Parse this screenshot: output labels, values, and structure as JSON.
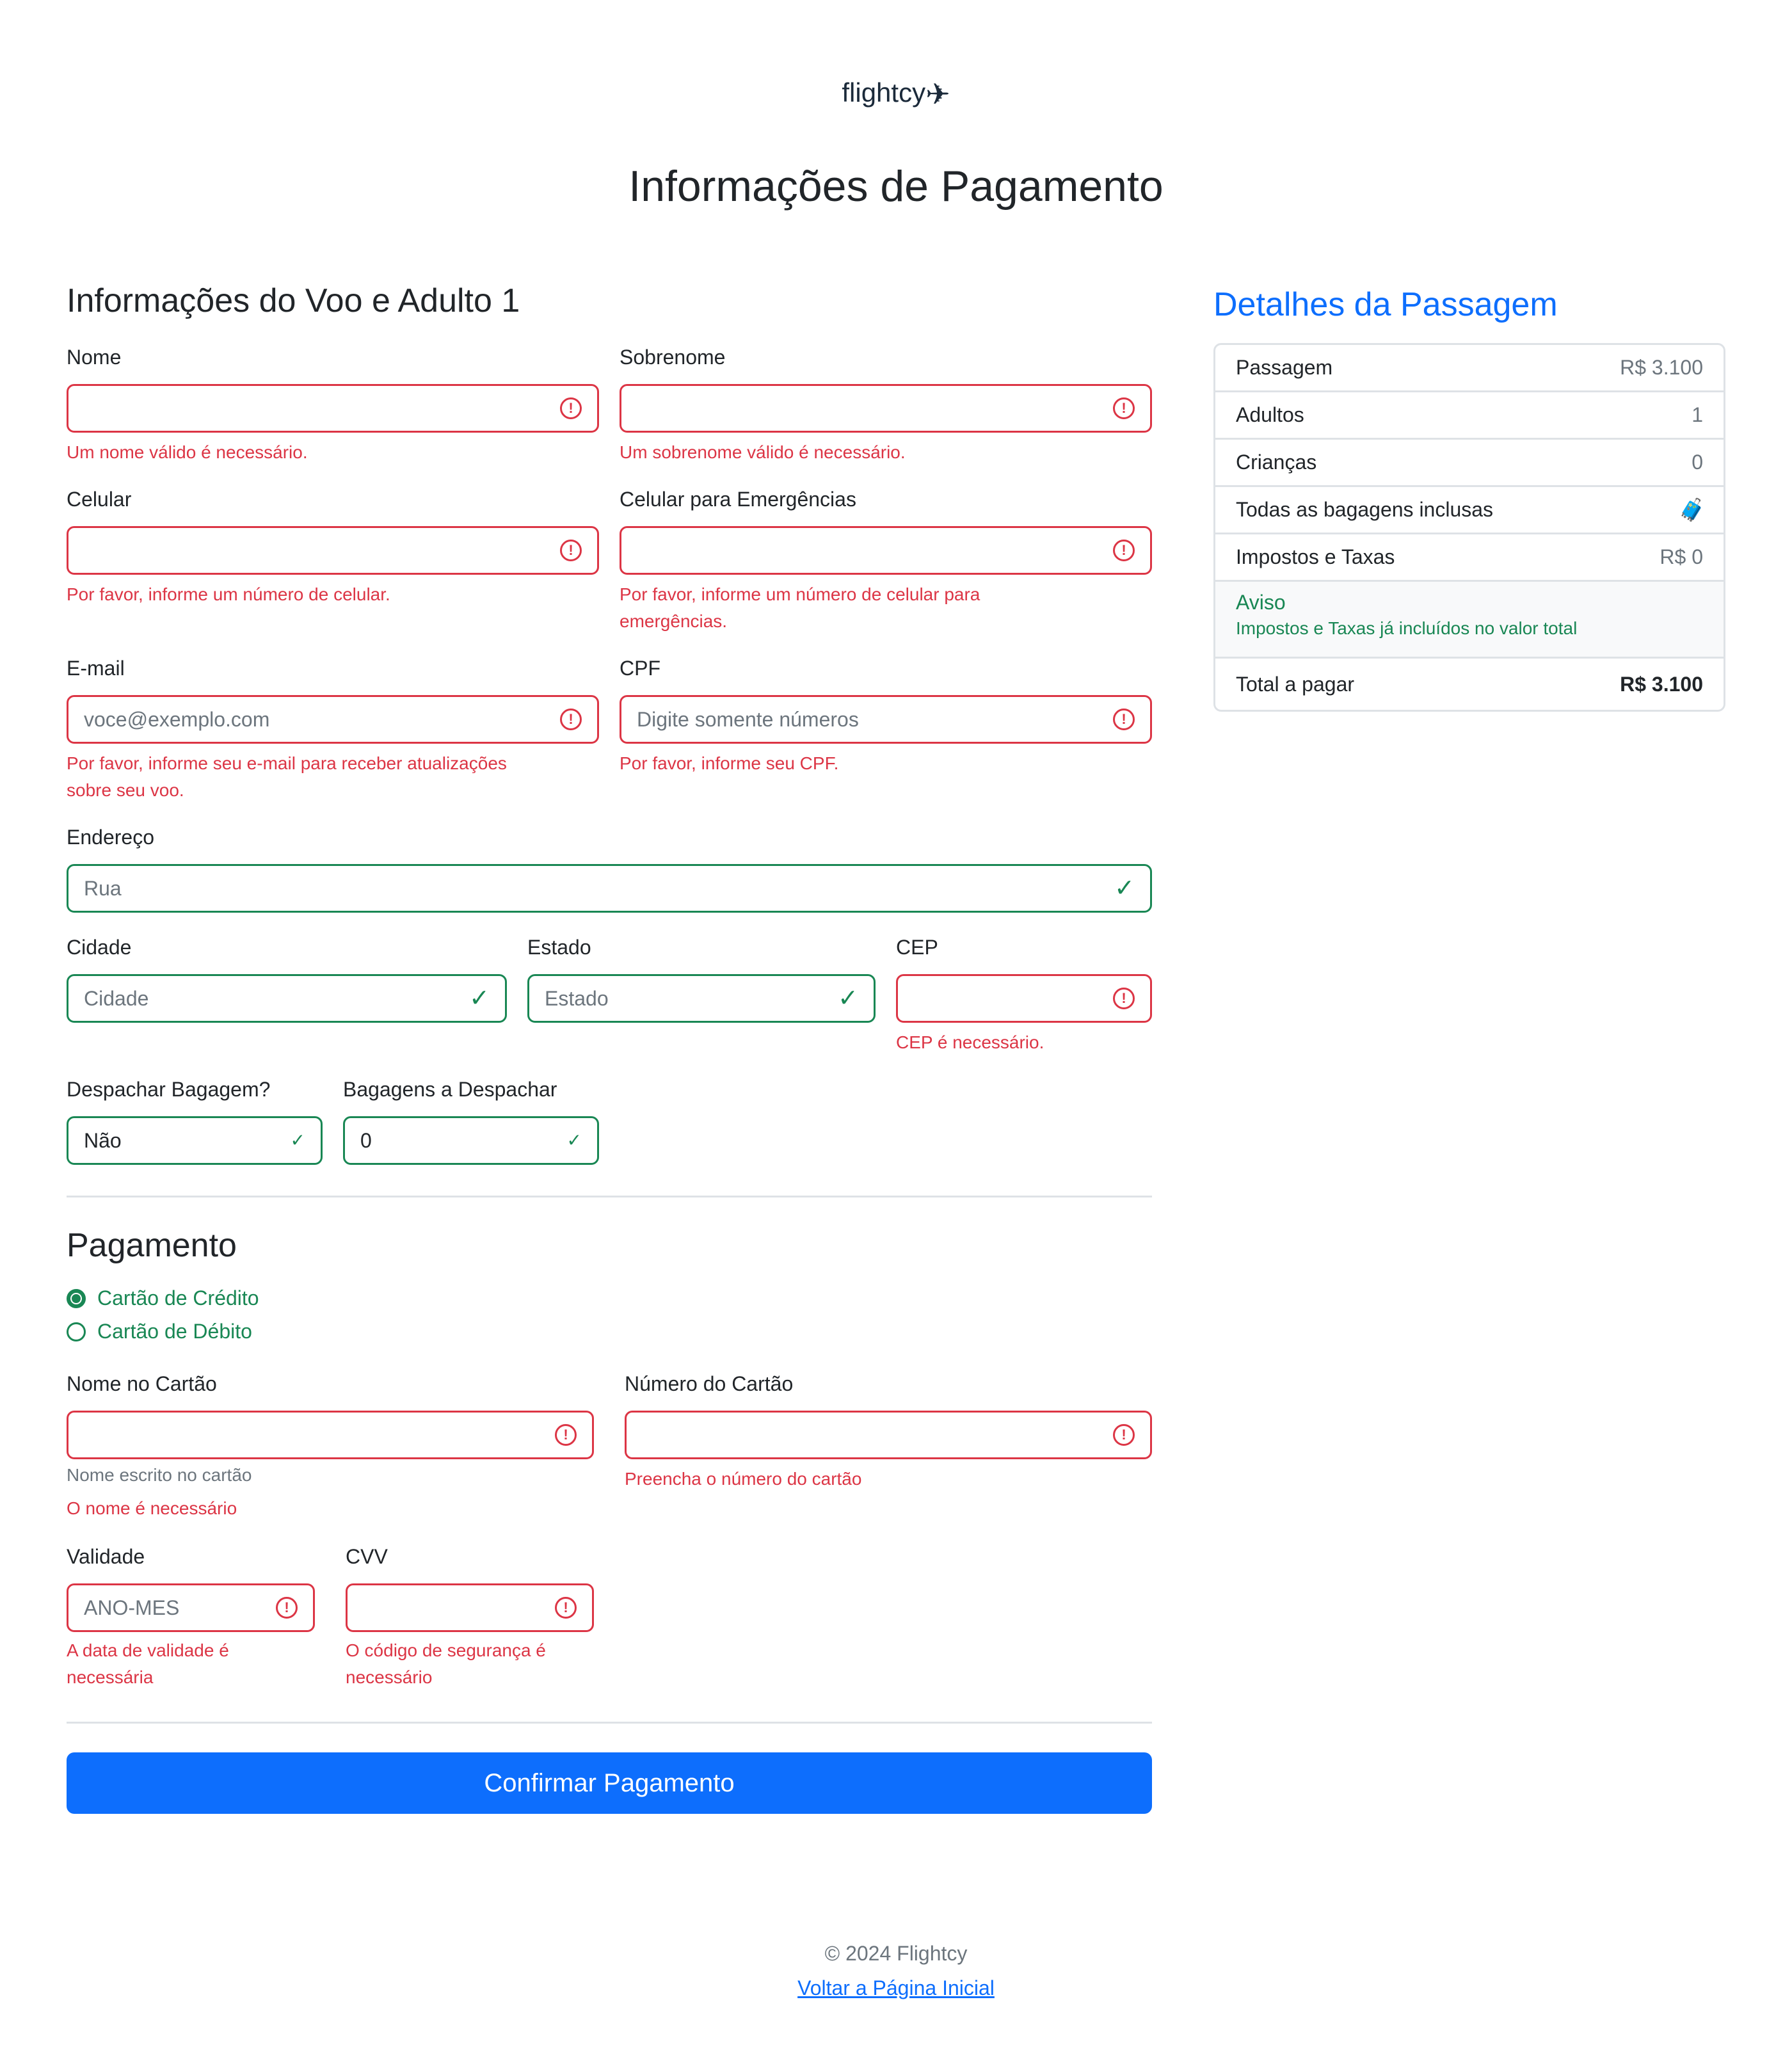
{
  "brand": {
    "logo_text": "flightcy",
    "logo_icon": "plane-icon"
  },
  "page_title": "Informações de Pagamento",
  "flight_section": {
    "title": "Informações do Voo e Adulto 1",
    "nome": {
      "label": "Nome",
      "value": "",
      "error": "Um nome válido é necessário."
    },
    "sobrenome": {
      "label": "Sobrenome",
      "value": "",
      "error": "Um sobrenome válido é necessário."
    },
    "celular": {
      "label": "Celular",
      "value": "",
      "error": "Por favor, informe um número de celular."
    },
    "celular_emergencia": {
      "label": "Celular para Emergências",
      "value": "",
      "error_line1": "Por favor, informe um número de celular para",
      "error_line2": "emergências."
    },
    "email": {
      "label": "E-mail",
      "placeholder": "voce@exemplo.com",
      "error_line1": "Por favor, informe seu e-mail para receber atualizações",
      "error_line2": "sobre seu voo."
    },
    "cpf": {
      "label": "CPF",
      "placeholder": "Digite somente números",
      "error": "Por favor, informe seu CPF."
    },
    "endereco": {
      "label": "Endereço",
      "placeholder": "Rua"
    },
    "cidade": {
      "label": "Cidade",
      "placeholder": "Cidade"
    },
    "estado": {
      "label": "Estado",
      "placeholder": "Estado"
    },
    "cep": {
      "label": "CEP",
      "value": "",
      "error": "CEP é necessário."
    },
    "despachar_bagagem": {
      "label": "Despachar Bagagem?",
      "value": "Não"
    },
    "bagagens_despachar": {
      "label": "Bagagens a Despachar",
      "value": "0"
    }
  },
  "payment_section": {
    "title": "Pagamento",
    "methods": [
      {
        "label": "Cartão de Crédito",
        "selected": true
      },
      {
        "label": "Cartão de Débito",
        "selected": false
      }
    ],
    "nome_cartao": {
      "label": "Nome no Cartão",
      "value": "",
      "help": "Nome escrito no cartão",
      "error": "O nome é necessário"
    },
    "numero_cartao": {
      "label": "Número do Cartão",
      "value": "",
      "error": "Preencha o número do cartão"
    },
    "validade": {
      "label": "Validade",
      "placeholder": "ANO-MES",
      "error_line1": "A data de validade é",
      "error_line2": "necessária"
    },
    "cvv": {
      "label": "CVV",
      "value": "",
      "error_line1": "O código de segurança é",
      "error_line2": "necessário"
    },
    "submit_label": "Confirmar Pagamento"
  },
  "summary": {
    "title": "Detalhes da Passagem",
    "rows": [
      {
        "label": "Passagem",
        "value": "R$ 3.100"
      },
      {
        "label": "Adultos",
        "value": "1"
      },
      {
        "label": "Crianças",
        "value": "0"
      },
      {
        "label": "Todas as bagagens inclusas",
        "value_icon": "luggage-icon"
      },
      {
        "label": "Impostos e Taxas",
        "value": "R$ 0"
      }
    ],
    "notice": {
      "title": "Aviso",
      "text": "Impostos e Taxas já incluídos no valor total"
    },
    "total": {
      "label": "Total a pagar",
      "value": "R$ 3.100"
    }
  },
  "footer": {
    "copyright": "© 2024 Flightcy",
    "home_link": "Voltar a Página Inicial"
  },
  "colors": {
    "primary": "#0d6efd",
    "danger": "#dc3545",
    "success": "#198754",
    "muted": "#6c757d"
  }
}
